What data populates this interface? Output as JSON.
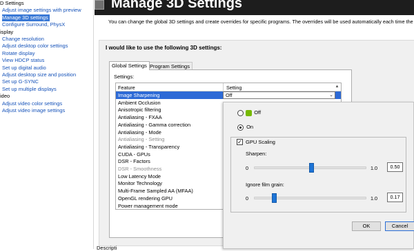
{
  "nav": {
    "items": [
      {
        "type": "cat",
        "label": "D Settings"
      },
      {
        "type": "link",
        "label": "Adjust image settings with preview"
      },
      {
        "type": "link",
        "label": "Manage 3D settings",
        "selected": true
      },
      {
        "type": "link",
        "label": "Configure Surround, PhysX"
      },
      {
        "type": "cat",
        "label": "isplay"
      },
      {
        "type": "link",
        "label": "Change resolution"
      },
      {
        "type": "link",
        "label": "Adjust desktop color settings"
      },
      {
        "type": "link",
        "label": "Rotate display"
      },
      {
        "type": "link",
        "label": "View HDCP status"
      },
      {
        "type": "link",
        "label": "Set up digital audio"
      },
      {
        "type": "link",
        "label": "Adjust desktop size and position"
      },
      {
        "type": "link",
        "label": "Set up G-SYNC"
      },
      {
        "type": "link",
        "label": "Set up multiple displays"
      },
      {
        "type": "cat",
        "label": "ideo"
      },
      {
        "type": "link",
        "label": "Adjust video color settings"
      },
      {
        "type": "link",
        "label": "Adjust video image settings"
      }
    ]
  },
  "header": {
    "title": "Manage 3D Settings",
    "description": "You can change the global 3D settings and create overrides for specific programs. The overrides will be used automatically each time the"
  },
  "main": {
    "heading": "I would like to use the following 3D settings:",
    "tabs": [
      {
        "label": "Global Settings",
        "active": true
      },
      {
        "label": "Program Settings",
        "active": false
      }
    ],
    "settings_label": "Settings:",
    "table": {
      "col_feature": "Feature",
      "col_setting": "Setting",
      "selected_setting_value": "Off",
      "rows": [
        {
          "label": "Image Sharpening",
          "selected": true
        },
        {
          "label": "Ambient Occlusion"
        },
        {
          "label": "Anisotropic filtering"
        },
        {
          "label": "Antialiasing - FXAA"
        },
        {
          "label": "Antialiasing - Gamma correction"
        },
        {
          "label": "Antialiasing - Mode"
        },
        {
          "label": "Antialiasing - Setting",
          "disabled": true
        },
        {
          "label": "Antialiasing - Transparency"
        },
        {
          "label": "CUDA - GPUs"
        },
        {
          "label": "DSR - Factors"
        },
        {
          "label": "DSR - Smoothness",
          "disabled": true
        },
        {
          "label": "Low Latency Mode"
        },
        {
          "label": "Monitor Technology"
        },
        {
          "label": "Multi-Frame Sampled AA (MFAA)"
        },
        {
          "label": "OpenGL rendering GPU"
        },
        {
          "label": "Power management mode"
        }
      ]
    },
    "bottom_text": "Descripti"
  },
  "popup": {
    "option_off": "Off",
    "option_on": "On",
    "selected_option": "on",
    "gpu_scaling_label": "GPU Scaling",
    "gpu_scaling_checked": "✓",
    "sharpen_label": "Sharpen:",
    "sharpen": {
      "min": "0",
      "max": "1.0",
      "value": "0.50",
      "fraction": 0.5
    },
    "grain_label": "Ignore film grain:",
    "grain": {
      "min": "0",
      "max": "1.0",
      "value": "0.17",
      "fraction": 0.17
    },
    "ok_label": "OK",
    "cancel_label": "Cancel"
  },
  "colors": {
    "nav_link": "#1552b9",
    "selection": "#2d6ad6",
    "slider_thumb": "#1e74d6",
    "nvidia_green": "#76b900"
  }
}
